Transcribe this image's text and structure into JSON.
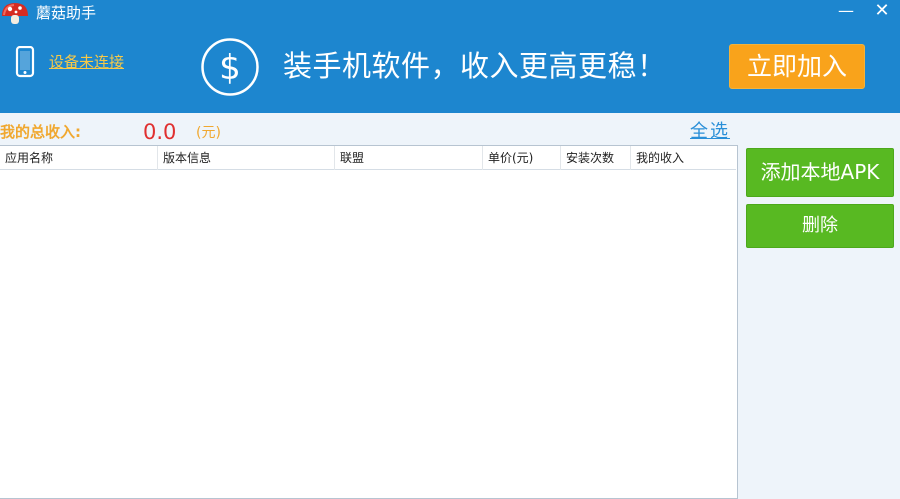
{
  "window": {
    "title": "蘑菇助手",
    "minimize_glyph": "—",
    "close_glyph": "✕"
  },
  "header": {
    "device_status": "设备未连接",
    "banner_text": "装手机软件，收入更高更稳！",
    "join_button": "立即加入"
  },
  "income": {
    "label": "我的总收入:",
    "value": "0.0",
    "unit": "(元)",
    "select_all": "全选"
  },
  "table": {
    "columns": [
      "应用名称",
      "版本信息",
      "联盟",
      "单价(元)",
      "安装次数",
      "我的收入"
    ],
    "rows": []
  },
  "actions": {
    "add_apk": "添加本地APK",
    "delete": "删除"
  },
  "colors": {
    "header_bg": "#1d86cf",
    "join_button": "#f9a31b",
    "action_green": "#58b922",
    "income_value": "#e03030",
    "income_label": "#f0a830",
    "link_blue": "#2a8fd8"
  },
  "icons": {
    "app_logo": "mushroom-logo-icon",
    "device": "phone-icon",
    "banner": "dollar-circle-icon"
  }
}
